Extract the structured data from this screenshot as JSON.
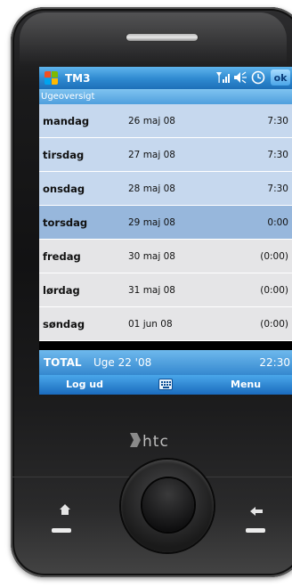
{
  "device": {
    "brand": "htc"
  },
  "titlebar": {
    "app_title": "TM3",
    "ok_label": "ok",
    "icons": [
      "start-logo-icon",
      "signal-icon",
      "volume-icon",
      "clock-icon"
    ]
  },
  "screen": {
    "subtitle": "Ugeoversigt"
  },
  "days": [
    {
      "day": "mandag",
      "date": "26 maj 08",
      "hours": "7:30"
    },
    {
      "day": "tirsdag",
      "date": "27 maj 08",
      "hours": "7:30"
    },
    {
      "day": "onsdag",
      "date": "28 maj 08",
      "hours": "7:30"
    },
    {
      "day": "torsdag",
      "date": "29 maj 08",
      "hours": "0:00"
    },
    {
      "day": "fredag",
      "date": "30 maj 08",
      "hours": "(0:00)"
    },
    {
      "day": "lørdag",
      "date": "31 maj 08",
      "hours": "(0:00)"
    },
    {
      "day": "søndag",
      "date": "01 jun 08",
      "hours": "(0:00)"
    }
  ],
  "total": {
    "label": "TOTAL",
    "week": "Uge 22 '08",
    "sum": "22:30"
  },
  "softkeys": {
    "left": "Log ud",
    "right": "Menu"
  },
  "colors": {
    "titlebar": "#2e89d0",
    "weekday_row": "#c6d8ee",
    "weekend_row": "#e5e5e7",
    "selected_row": "#97b7dc",
    "total_bar": "#3588cf"
  }
}
